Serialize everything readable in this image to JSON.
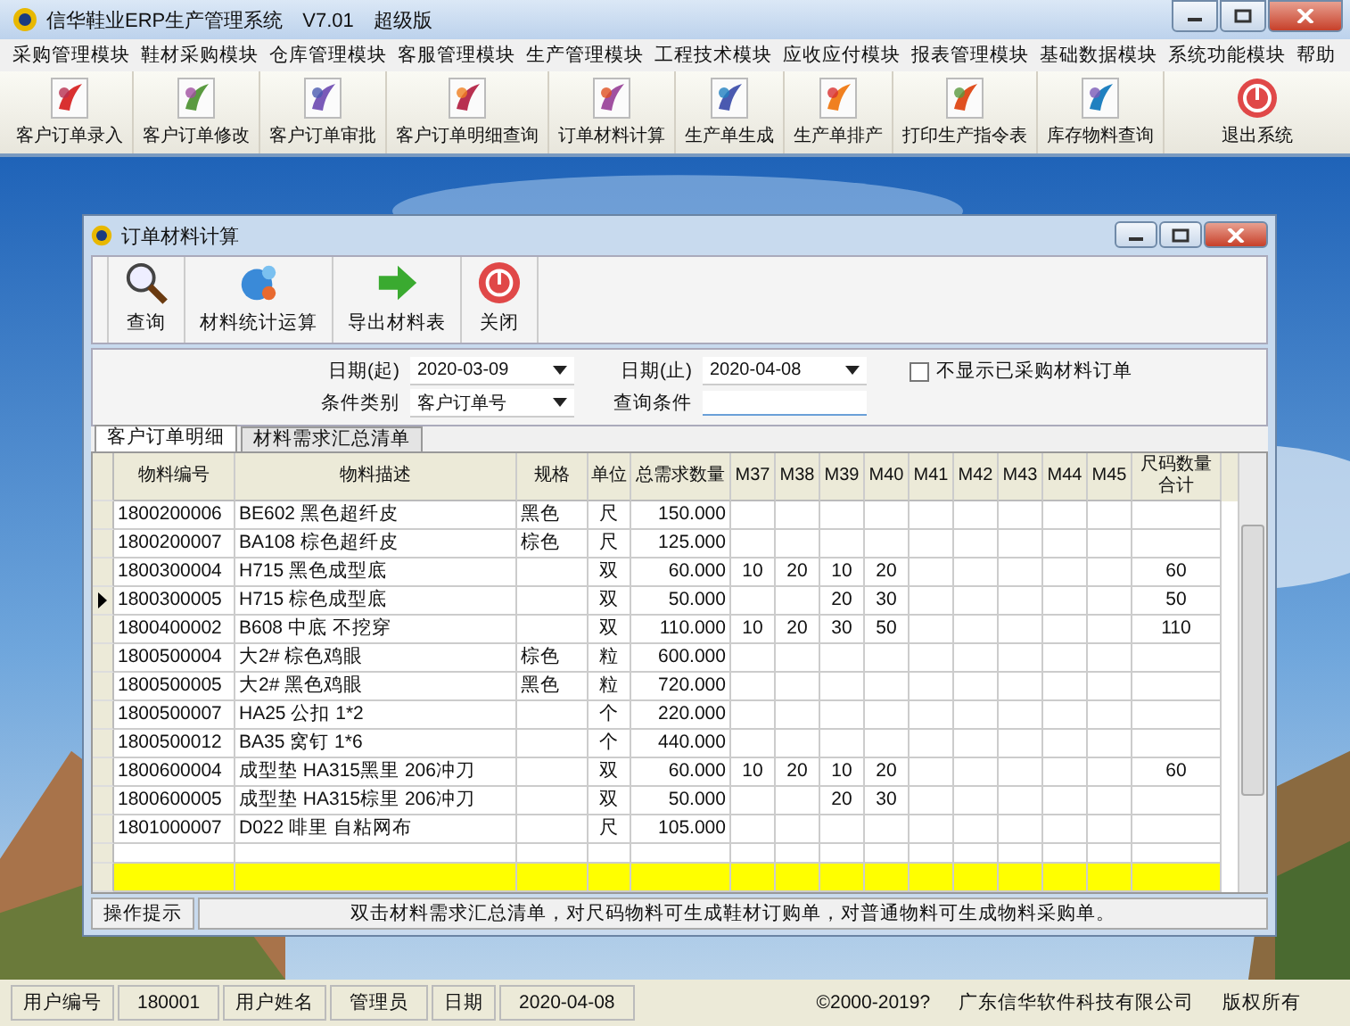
{
  "window": {
    "title": "信华鞋业ERP生产管理系统　V7.01　超级版"
  },
  "menu": [
    "采购管理模块",
    "鞋材采购模块",
    "仓库管理模块",
    "客服管理模块",
    "生产管理模块",
    "工程技术模块",
    "应收应付模块",
    "报表管理模块",
    "基础数据模块",
    "系统功能模块",
    "帮助"
  ],
  "toolbar": [
    "客户订单录入",
    "客户订单修改",
    "客户订单审批",
    "客户订单明细查询",
    "订单材料计算",
    "生产单生成",
    "生产单排产",
    "打印生产指令表",
    "库存物料查询",
    "退出系统"
  ],
  "child_window": {
    "title": "订单材料计算",
    "toolbar": [
      "查询",
      "材料统计运算",
      "导出材料表",
      "关闭"
    ],
    "filters": {
      "date_from": {
        "label": "日期(起)",
        "value": "2020-03-09"
      },
      "date_to": {
        "label": "日期(止)",
        "value": "2020-04-08"
      },
      "condition_type": {
        "label": "条件类别",
        "value": "客户订单号"
      },
      "query": {
        "label": "查询条件"
      },
      "hide_purchased": {
        "label": "不显示已采购材料订单",
        "checked": false
      }
    },
    "tabs": [
      {
        "label": "客户订单明细",
        "selected": true
      },
      {
        "label": "材料需求汇总清单",
        "selected": false
      }
    ],
    "table": {
      "columns": [
        "物料编号",
        "物料描述",
        "规格",
        "单位",
        "总需求数量",
        "M37",
        "M38",
        "M39",
        "M40",
        "M41",
        "M42",
        "M43",
        "M44",
        "M45",
        "尺码数量合计"
      ],
      "rows": [
        {
          "selected": false,
          "code": "1800200006",
          "desc": "BE602 黑色超纤皮",
          "spec": "黑色",
          "unit": "尺",
          "qty": "150.000"
        },
        {
          "selected": false,
          "code": "1800200007",
          "desc": "BA108 棕色超纤皮",
          "spec": "棕色",
          "unit": "尺",
          "qty": "125.000"
        },
        {
          "selected": false,
          "code": "1800300004",
          "desc": "H715 黑色成型底",
          "unit": "双",
          "qty": "60.000",
          "m37": "10",
          "m38": "20",
          "m39": "10",
          "m40": "20",
          "total": "60"
        },
        {
          "selected": true,
          "code": "1800300005",
          "desc": "H715 棕色成型底",
          "unit": "双",
          "qty": "50.000",
          "m39": "20",
          "m40": "30",
          "total": "50"
        },
        {
          "selected": false,
          "code": "1800400002",
          "desc": "B608 中底 不挖穿",
          "unit": "双",
          "qty": "110.000",
          "m37": "10",
          "m38": "20",
          "m39": "30",
          "m40": "50",
          "total": "110"
        },
        {
          "selected": false,
          "code": "1800500004",
          "desc": "大2# 棕色鸡眼",
          "spec": "棕色",
          "unit": "粒",
          "qty": "600.000"
        },
        {
          "selected": false,
          "code": "1800500005",
          "desc": "大2# 黑色鸡眼",
          "spec": "黑色",
          "unit": "粒",
          "qty": "720.000"
        },
        {
          "selected": false,
          "code": "1800500007",
          "desc": "HA25 公扣 1*2",
          "unit": "个",
          "qty": "220.000"
        },
        {
          "selected": false,
          "code": "1800500012",
          "desc": "BA35 窝钉 1*6",
          "unit": "个",
          "qty": "440.000"
        },
        {
          "selected": false,
          "code": "1800600004",
          "desc": "成型垫 HA315黑里 206冲刀",
          "unit": "双",
          "qty": "60.000",
          "m37": "10",
          "m38": "20",
          "m39": "10",
          "m40": "20",
          "total": "60"
        },
        {
          "selected": false,
          "code": "1800600005",
          "desc": "成型垫 HA315棕里 206冲刀",
          "unit": "双",
          "qty": "50.000",
          "m39": "20",
          "m40": "30"
        },
        {
          "selected": false,
          "code": "1801000007",
          "desc": "D022 啡里 自粘网布",
          "unit": "尺",
          "qty": "105.000"
        }
      ]
    },
    "hint": {
      "label": "操作提示",
      "text": "双击材料需求汇总清单，对尺码物料可生成鞋材订购单，对普通物料可生成物料采购单。"
    }
  },
  "status_bar": {
    "fields": [
      {
        "label": "用户编号",
        "value": "180001"
      },
      {
        "label": "用户姓名",
        "value": "管理员"
      },
      {
        "label": "日期",
        "value": "2020-04-08"
      }
    ],
    "copyright": "©2000-2019?",
    "company": "广东信华软件科技有限公司",
    "rights": "版权所有"
  }
}
